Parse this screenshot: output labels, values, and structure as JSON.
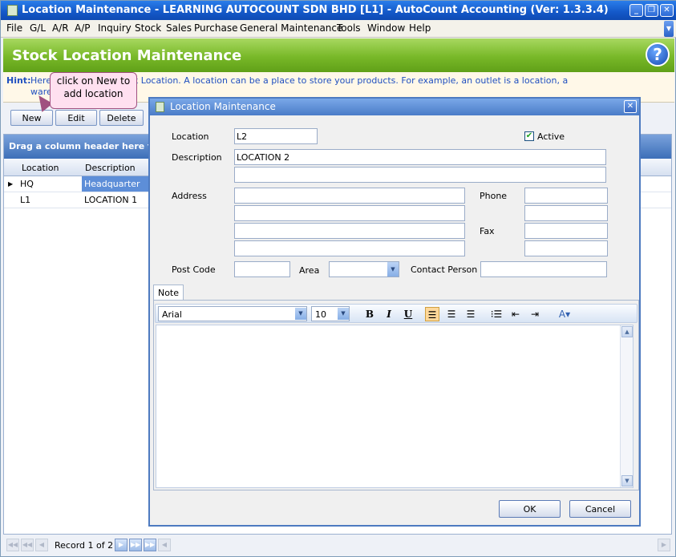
{
  "window": {
    "title": "Location Maintenance - LEARNING AUTOCOUNT SDN BHD [L1] - AutoCount Accounting (Ver: 1.3.3.4)",
    "minimize": "_",
    "restore": "❐",
    "close": "✕"
  },
  "menu": [
    "File",
    "G/L",
    "A/R",
    "A/P",
    "Inquiry",
    "Stock",
    "Sales",
    "Purchase",
    "General Maintenance",
    "Tools",
    "Window",
    "Help"
  ],
  "banner": {
    "title": "Stock Location Maintenance",
    "help": "?"
  },
  "hint": {
    "label": "Hint:",
    "line1": "Here                                   dit, or delete Stock Location. A location can be a place to store your products. For example, an outlet is a location, a",
    "line2": "ware"
  },
  "callout": {
    "line1": "click on New to",
    "line2": "add location"
  },
  "buttons": {
    "new": "New",
    "edit": "Edit",
    "delete": "Delete"
  },
  "grid": {
    "group_hint": "Drag a column header here to g",
    "columns": [
      "Location",
      "Description"
    ],
    "rows": [
      {
        "location": "HQ",
        "description": "Headquarter"
      },
      {
        "location": "L1",
        "description": "LOCATION 1"
      }
    ]
  },
  "footer": {
    "record": "Record 1 of 2"
  },
  "dialog": {
    "title": "Location Maintenance",
    "close": "✕",
    "labels": {
      "location": "Location",
      "description": "Description",
      "address": "Address",
      "phone": "Phone",
      "fax": "Fax",
      "postcode": "Post Code",
      "area": "Area",
      "contact": "Contact Person",
      "active": "Active"
    },
    "values": {
      "location": "L2",
      "description1": "LOCATION 2",
      "description2": "",
      "active": true
    },
    "note_tab": "Note",
    "font_name": "Arial",
    "font_size": "10",
    "ok": "OK",
    "cancel": "Cancel"
  }
}
